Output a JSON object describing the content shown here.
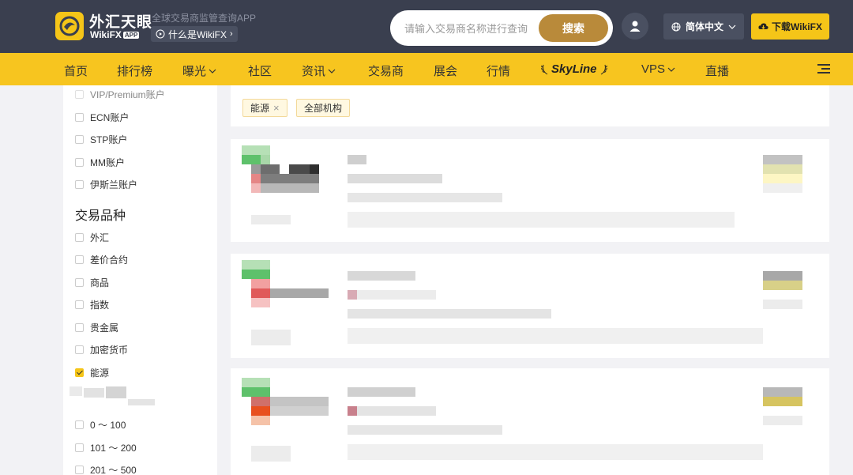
{
  "header": {
    "logo_cn": "外汇天眼",
    "logo_en": "WikiFX",
    "logo_app": "APP",
    "tagline": "全球交易商监管查询APP",
    "whatis_label": "什么是WikiFX",
    "search_placeholder": "请输入交易商名称进行查询",
    "search_button": "搜索",
    "language": "简体中文",
    "download_button": "下载WikiFX"
  },
  "nav": {
    "items": [
      {
        "label": "首页",
        "dropdown": false
      },
      {
        "label": "排行榜",
        "dropdown": false
      },
      {
        "label": "曝光",
        "dropdown": true
      },
      {
        "label": "社区",
        "dropdown": false
      },
      {
        "label": "资讯",
        "dropdown": true
      },
      {
        "label": "交易商",
        "dropdown": false
      },
      {
        "label": "展会",
        "dropdown": false
      },
      {
        "label": "行情",
        "dropdown": false
      },
      {
        "label": "SkyLine",
        "dropdown": false
      },
      {
        "label": "VPS",
        "dropdown": true
      },
      {
        "label": "直播",
        "dropdown": false
      }
    ]
  },
  "sidebar": {
    "account_types": [
      {
        "label": "VIP/Premium账户",
        "checked": false
      },
      {
        "label": "ECN账户",
        "checked": false
      },
      {
        "label": "STP账户",
        "checked": false
      },
      {
        "label": "MM账户",
        "checked": false
      },
      {
        "label": "伊斯兰账户",
        "checked": false
      }
    ],
    "products_title": "交易品种",
    "products": [
      {
        "label": "外汇",
        "checked": false
      },
      {
        "label": "差价合约",
        "checked": false
      },
      {
        "label": "商品",
        "checked": false
      },
      {
        "label": "指数",
        "checked": false
      },
      {
        "label": "贵金属",
        "checked": false
      },
      {
        "label": "加密货币",
        "checked": false
      },
      {
        "label": "能源",
        "checked": true
      }
    ],
    "ranges": [
      {
        "label": "0 ～ 100",
        "checked": false
      },
      {
        "label": "101 ～ 200",
        "checked": false
      },
      {
        "label": "201 ～ 500",
        "checked": false
      }
    ]
  },
  "filters": {
    "tags": [
      {
        "label": "能源",
        "removable": true
      },
      {
        "label": "全部机构",
        "removable": false
      }
    ]
  },
  "colors": {
    "header_bg": "#3a3f4f",
    "nav_bg": "#f7c51f",
    "accent_gold": "#b98a3a",
    "brand_yellow": "#f5c518"
  }
}
